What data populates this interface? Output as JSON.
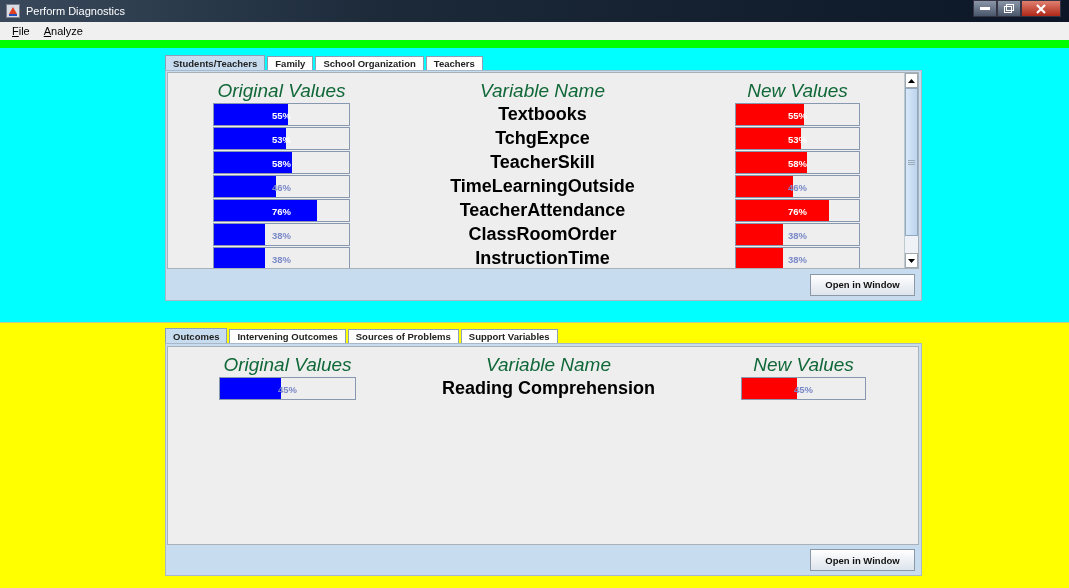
{
  "window": {
    "title": "Perform Diagnostics"
  },
  "menu": [
    "File",
    "Analyze"
  ],
  "panels": [
    {
      "tabs": [
        {
          "label": "Students/Teachers",
          "selected": true
        },
        {
          "label": "Family",
          "selected": false
        },
        {
          "label": "School Organization",
          "selected": false
        },
        {
          "label": "Teachers",
          "selected": false
        }
      ],
      "headings": [
        "Original Values",
        "Variable Name",
        "New Values"
      ],
      "scrollable": true,
      "rows": [
        {
          "name": "Textbooks",
          "original": {
            "level": 0.55,
            "text": "55%"
          },
          "new": {
            "level": 0.55,
            "text": "55%"
          }
        },
        {
          "name": "TchgExpce",
          "original": {
            "level": 0.53,
            "text": "53%"
          },
          "new": {
            "level": 0.53,
            "text": "53%"
          }
        },
        {
          "name": "TeacherSkill",
          "original": {
            "level": 0.58,
            "text": "58%"
          },
          "new": {
            "level": 0.58,
            "text": "58%"
          }
        },
        {
          "name": "TimeLearningOutside",
          "original": {
            "level": 0.46,
            "text": "46%"
          },
          "new": {
            "level": 0.46,
            "text": "46%"
          }
        },
        {
          "name": "TeacherAttendance",
          "original": {
            "level": 0.76,
            "text": "76%"
          },
          "new": {
            "level": 0.76,
            "text": "76%"
          }
        },
        {
          "name": "ClassRoomOrder",
          "original": {
            "level": 0.38,
            "text": "38%"
          },
          "new": {
            "level": 0.38,
            "text": "38%"
          }
        },
        {
          "name": "InstructionTime",
          "original": {
            "level": 0.38,
            "text": "38%"
          },
          "new": {
            "level": 0.38,
            "text": "38%"
          }
        }
      ],
      "button": "Open in Window"
    },
    {
      "tabs": [
        {
          "label": "Outcomes",
          "selected": true
        },
        {
          "label": "Intervening Outcomes",
          "selected": false
        },
        {
          "label": "Sources of Problems",
          "selected": false
        },
        {
          "label": "Support Variables",
          "selected": false
        }
      ],
      "headings": [
        "Original Values",
        "Variable Name",
        "New Values"
      ],
      "scrollable": false,
      "rows": [
        {
          "name": "Reading Comprehension",
          "original": {
            "level": 0.45,
            "text": "45%"
          },
          "new": {
            "level": 0.45,
            "text": "45%"
          }
        }
      ],
      "button": "Open in Window"
    }
  ]
}
